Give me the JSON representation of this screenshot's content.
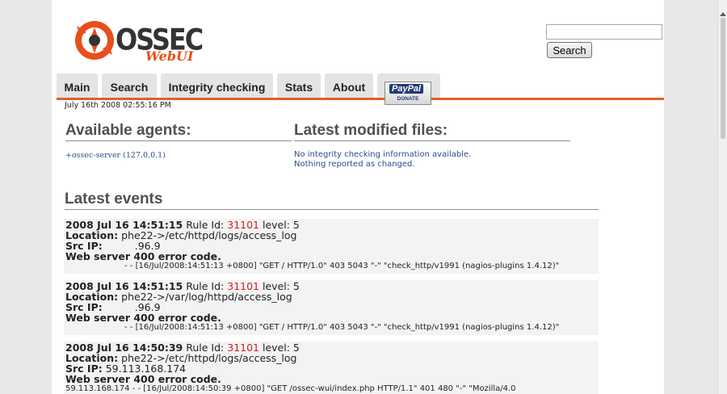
{
  "logo": {
    "name": "OSSEC",
    "sub": "WebUI"
  },
  "search": {
    "placeholder": "",
    "button_label": "Search"
  },
  "tabs": [
    "Main",
    "Search",
    "Integrity checking",
    "Stats",
    "About"
  ],
  "donate": {
    "brand": "PayPal",
    "label": "DONATE"
  },
  "timestamp": "July 16th 2008 02:55:16 PM",
  "agents": {
    "title": "Available agents:",
    "items": [
      "+ossec-server (127.0.0.1)"
    ]
  },
  "files": {
    "title": "Latest modified files:",
    "lines": [
      "No integrity checking information available.",
      "Nothing reported as changed."
    ]
  },
  "events": {
    "title": "Latest events",
    "rule_label": "Rule Id:",
    "level_label": "level:",
    "location_label": "Location:",
    "src_label": "Src IP:",
    "items": [
      {
        "date": "2008 Jul 16 14:51:15",
        "rule_id": "31101",
        "level": "5",
        "location": "phe22->/etc/httpd/logs/access_log",
        "src_ip": ".96.9",
        "description": "Web server 400 error code.",
        "log": "- - [16/Jul/2008:14:51:13 +0800] \"GET / HTTP/1.0\" 403 5043 \"-\" \"check_http/v1991 (nagios-plugins 1.4.12)\""
      },
      {
        "date": "2008 Jul 16 14:51:15",
        "rule_id": "31101",
        "level": "5",
        "location": "phe22->/var/log/httpd/access_log",
        "src_ip": ".96.9",
        "description": "Web server 400 error code.",
        "log": "- - [16/Jul/2008:14:51:13 +0800] \"GET / HTTP/1.0\" 403 5043 \"-\" \"check_http/v1991 (nagios-plugins 1.4.12)\""
      },
      {
        "date": "2008 Jul 16 14:50:39",
        "rule_id": "31101",
        "level": "5",
        "location": "phe22->/etc/httpd/logs/access_log",
        "src_ip": "59.113.168.174",
        "description": "Web server 400 error code.",
        "log": "59.113.168.174 - - [16/Jul/2008:14:50:39 +0800] \"GET /ossec-wui/index.php HTTP/1.1\" 401 480 \"-\" \"Mozilla/4.0"
      }
    ]
  },
  "colors": {
    "accent": "#e2602a",
    "link": "#2b4c8c",
    "rule_id": "#cc2020"
  }
}
